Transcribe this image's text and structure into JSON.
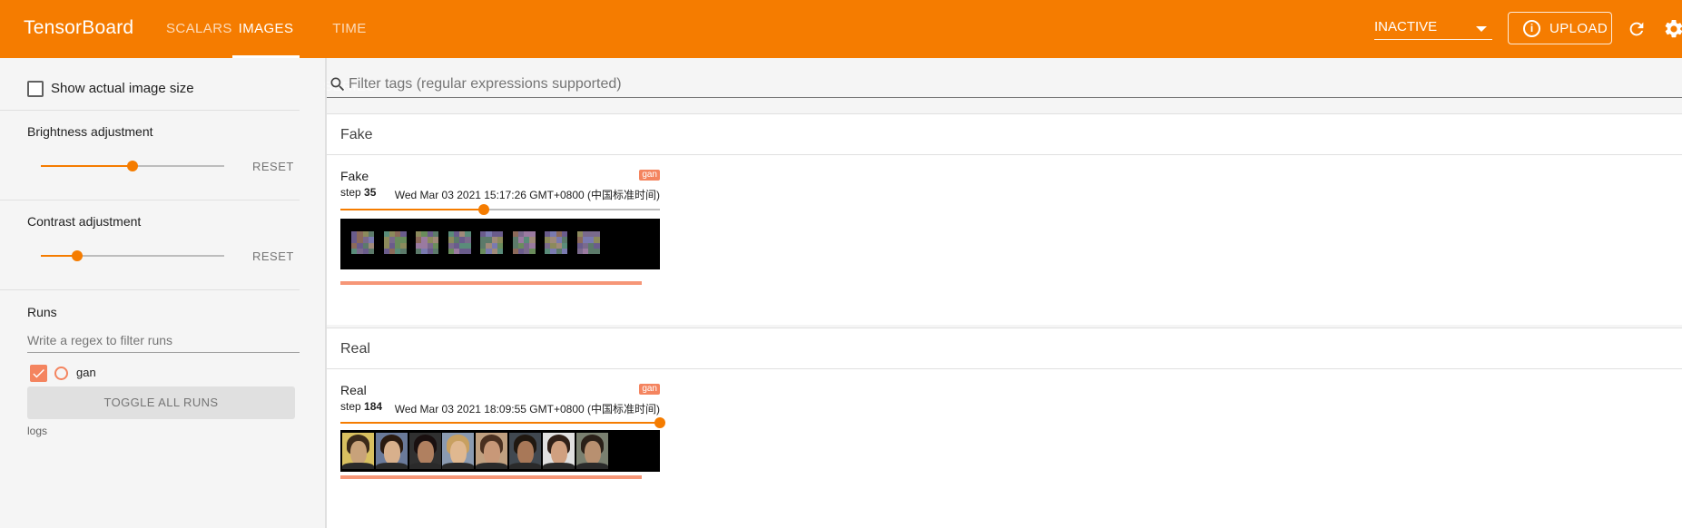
{
  "toolbar": {
    "brand": "TensorBoard",
    "tabs": [
      {
        "label": "SCALARS",
        "active": false
      },
      {
        "label": "IMAGES",
        "active": true
      },
      {
        "label": "TIME SERIES",
        "active": false
      }
    ],
    "status_select": "INACTIVE",
    "upload_label": "UPLOAD",
    "accent_color": "#f57c00"
  },
  "sidebar": {
    "show_actual_size_label": "Show actual image size",
    "show_actual_size_checked": false,
    "brightness": {
      "label": "Brightness adjustment",
      "value": 0.5,
      "reset_label": "RESET"
    },
    "contrast": {
      "label": "Contrast adjustment",
      "value": 0.2,
      "reset_label": "RESET"
    },
    "runs_title": "Runs",
    "runs_filter_placeholder": "Write a regex to filter runs",
    "runs": [
      {
        "name": "gan",
        "checked": true,
        "color": "#f4845f"
      }
    ],
    "toggle_all_label": "TOGGLE ALL RUNS",
    "logdir": "logs"
  },
  "main": {
    "filter_placeholder": "Filter tags (regular expressions supported)",
    "panes": [
      {
        "title": "Fake",
        "card": {
          "tag": "Fake",
          "run": "gan",
          "step_label": "step",
          "step": "35",
          "timestamp": "Wed Mar 03 2021 15:17:26 GMT+0800 (中国标准时间)",
          "slider_value": 0.45,
          "image_kind": "noise-grid"
        }
      },
      {
        "title": "Real",
        "card": {
          "tag": "Real",
          "run": "gan",
          "step_label": "step",
          "step": "184",
          "timestamp": "Wed Mar 03 2021 18:09:55 GMT+0800 (中国标准时间)",
          "slider_value": 1.0,
          "image_kind": "face-photos"
        }
      }
    ]
  },
  "icons": {
    "search": "search-icon",
    "reload": "reload-icon",
    "settings": "gear-icon",
    "info": "info-icon"
  }
}
